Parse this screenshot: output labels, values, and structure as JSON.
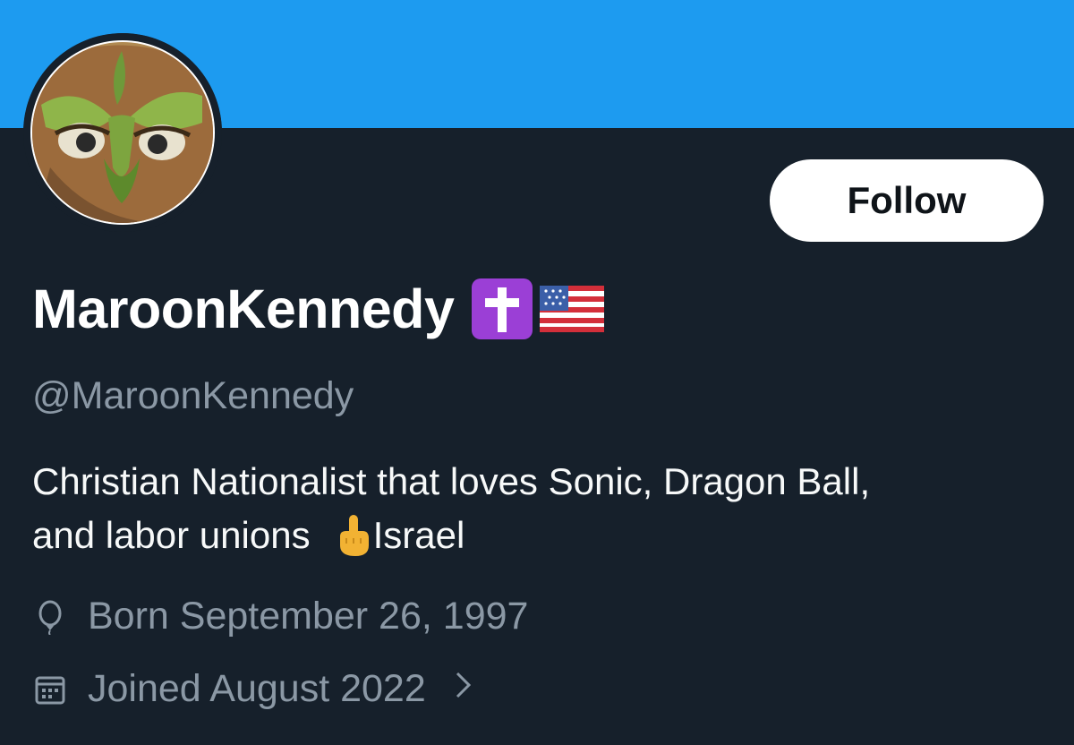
{
  "colors": {
    "banner": "#1d9bf0",
    "background": "#16202b",
    "name_text": "#ffffff",
    "secondary_text": "#8b98a5",
    "follow_button_bg": "#ffffff",
    "follow_button_text": "#0f1419"
  },
  "profile": {
    "avatar_icon": "owl-avatar-icon",
    "display_name": "MaroonKennedy",
    "name_emojis": [
      "latin-cross-icon",
      "us-flag-icon"
    ],
    "handle": "@MaroonKennedy",
    "bio_line_1": "Christian Nationalist that loves Sonic, Dragon Ball,",
    "bio_line_2_start": "and labor unions",
    "bio_emoji": "middle-finger-icon",
    "bio_line_2_end": "Israel",
    "born": "Born September 26, 1997",
    "joined": "Joined August 2022"
  },
  "actions": {
    "follow_label": "Follow"
  }
}
